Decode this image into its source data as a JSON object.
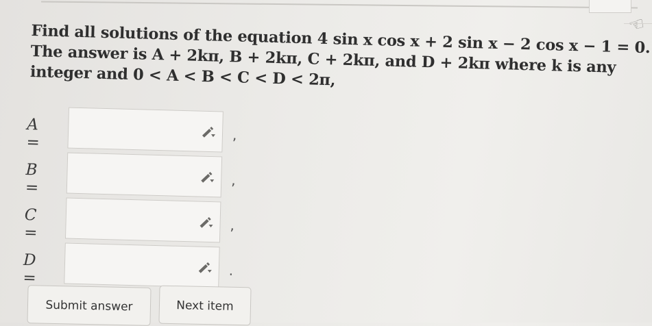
{
  "question": {
    "line1": "Find all solutions of the equation 4 sin x cos x + 2 sin x − 2 cos x − 1 = 0.",
    "line2": "The answer is A + 2kπ, B + 2kπ, C + 2kπ, and D + 2kπ where k is any",
    "line3": "integer and 0 < A < B < C < D < 2π,"
  },
  "answers": [
    {
      "label": "A =",
      "value": "",
      "punct": ","
    },
    {
      "label": "B =",
      "value": "",
      "punct": ","
    },
    {
      "label": "C =",
      "value": "",
      "punct": ","
    },
    {
      "label": "D =",
      "value": "",
      "punct": "."
    }
  ],
  "buttons": {
    "submit": "Submit answer",
    "next": "Next item"
  },
  "icons": {
    "edit": "pencil-icon",
    "corner": "hand-icon"
  }
}
